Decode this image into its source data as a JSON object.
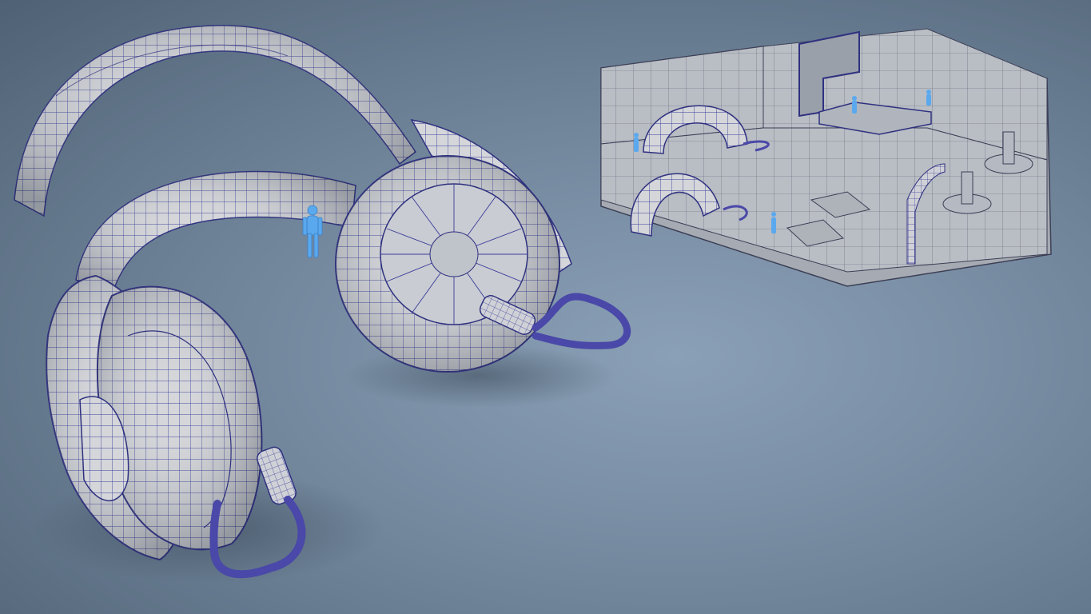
{
  "scene": {
    "background_color": "#6f8296",
    "mesh_color": "#dadbdf",
    "wire_color": "#3a3c9a",
    "figure_color": "#5aa9ee",
    "cable_color": "#4a48a8",
    "inset_floor_color": "#b7bcc3"
  }
}
